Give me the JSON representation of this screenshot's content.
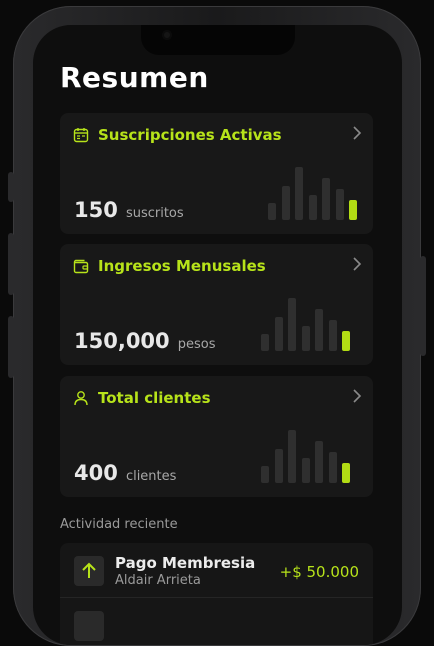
{
  "page": {
    "title": "Resumen"
  },
  "cards": [
    {
      "title": "Suscripciones Activas",
      "icon": "calendar-icon",
      "value": "150",
      "unit": "suscritos",
      "bars": [
        0.3,
        0.6,
        0.95,
        0.45,
        0.75,
        0.55,
        0.35
      ]
    },
    {
      "title": "Ingresos Menusales",
      "icon": "wallet-icon",
      "value": "150,000",
      "unit": "pesos",
      "bars": [
        0.3,
        0.6,
        0.95,
        0.45,
        0.75,
        0.55,
        0.35
      ]
    },
    {
      "title": "Total clientes",
      "icon": "user-icon",
      "value": "400",
      "unit": "clientes",
      "bars": [
        0.3,
        0.6,
        0.95,
        0.45,
        0.75,
        0.55,
        0.35
      ]
    }
  ],
  "recent_activity": {
    "label": "Actividad reciente",
    "items": [
      {
        "title": "Pago Membresia",
        "subtitle": "Aldair Arrieta",
        "amount": "+$ 50.000",
        "icon": "arrow-up-icon"
      }
    ]
  },
  "colors": {
    "accent": "#b7e31a",
    "card_bg": "#181818",
    "screen_bg": "#0e0e0e",
    "bar_inactive": "#2f2f2f"
  }
}
